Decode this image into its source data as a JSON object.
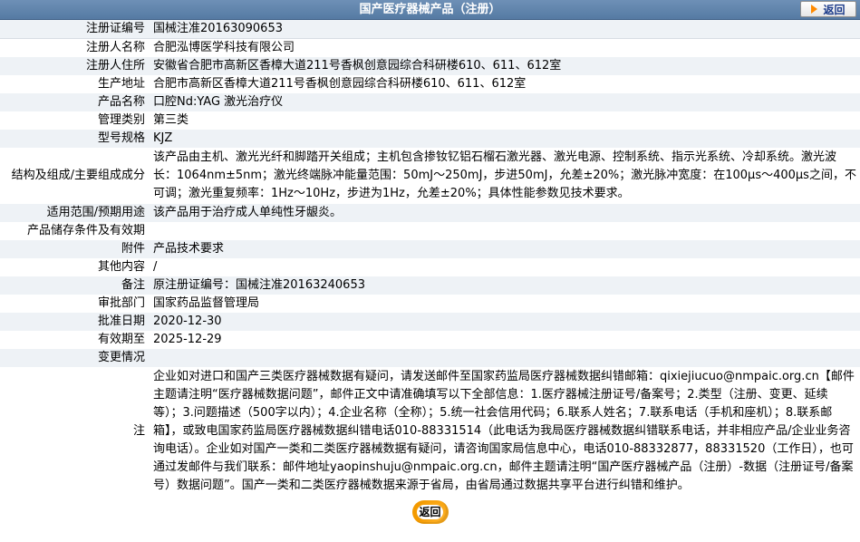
{
  "header": {
    "title": "国产医疗器械产品（注册）",
    "back_label": "返回"
  },
  "rows": [
    {
      "label": "注册证编号",
      "value": "国械注准20163090653"
    },
    {
      "label": "注册人名称",
      "value": "合肥泓博医学科技有限公司"
    },
    {
      "label": "注册人住所",
      "value": "安徽省合肥市高新区香樟大道211号香枫创意园综合科研楼610、611、612室"
    },
    {
      "label": "生产地址",
      "value": "合肥市高新区香樟大道211号香枫创意园综合科研楼610、611、612室"
    },
    {
      "label": "产品名称",
      "value": "口腔Nd:YAG 激光治疗仪"
    },
    {
      "label": "管理类别",
      "value": "第三类"
    },
    {
      "label": "型号规格",
      "value": "KJZ"
    },
    {
      "label": "结构及组成/主要组成成分",
      "value": "该产品由主机、激光光纤和脚踏开关组成；主机包含掺钕钇铝石榴石激光器、激光电源、控制系统、指示光系统、冷却系统。激光波长：1064nm±5nm；激光终端脉冲能量范围：50mJ～250mJ，步进50mJ，允差±20%；激光脉冲宽度：在100μs～400μs之间，不可调；激光重复频率：1Hz～10Hz，步进为1Hz，允差±20%；具体性能参数见技术要求。"
    },
    {
      "label": "适用范围/预期用途",
      "value": "该产品用于治疗成人单纯性牙龈炎。"
    },
    {
      "label": "产品储存条件及有效期",
      "value": ""
    },
    {
      "label": "附件",
      "value": "产品技术要求"
    },
    {
      "label": "其他内容",
      "value": "/"
    },
    {
      "label": "备注",
      "value": "原注册证编号：国械注准20163240653"
    },
    {
      "label": "审批部门",
      "value": "国家药品监督管理局"
    },
    {
      "label": "批准日期",
      "value": "2020-12-30"
    },
    {
      "label": "有效期至",
      "value": "2025-12-29"
    },
    {
      "label": "变更情况",
      "value": ""
    },
    {
      "label": "注",
      "value": "企业如对进口和国产三类医疗器械数据有疑问，请发送邮件至国家药监局医疗器械数据纠错邮箱：qixiejiucuo@nmpaic.org.cn【邮件主题请注明“医疗器械数据问题”，邮件正文中请准确填写以下全部信息：1.医疗器械注册证号/备案号；2.类型（注册、变更、延续等）；3.问题描述（500字以内）；4.企业名称（全称）；5.统一社会信用代码；6.联系人姓名；7.联系电话（手机和座机）；8.联系邮箱】，或致电国家药监局医疗器械数据纠错电话010-88331514（此电话为我局医疗器械数据纠错联系电话，并非相应产品/企业业务咨询电话）。企业如对国产一类和二类医疗器械数据有疑问，请咨询国家局信息中心，电话010-88332877，88331520（工作日），也可通过发邮件与我们联系：邮件地址yaopinshuju@nmpaic.org.cn，邮件主题请注明“国产医疗器械产品（注册）-数据（注册证号/备案号）数据问题”。国产一类和二类医疗器械数据来源于省局，由省局通过数据共享平台进行纠错和维护。"
    }
  ],
  "footer": {
    "back_label": "返回"
  },
  "colors": {
    "header_bg": "#5f84ad",
    "row_alt": "#eef2f6",
    "back_button_orange": "#f39a00"
  }
}
